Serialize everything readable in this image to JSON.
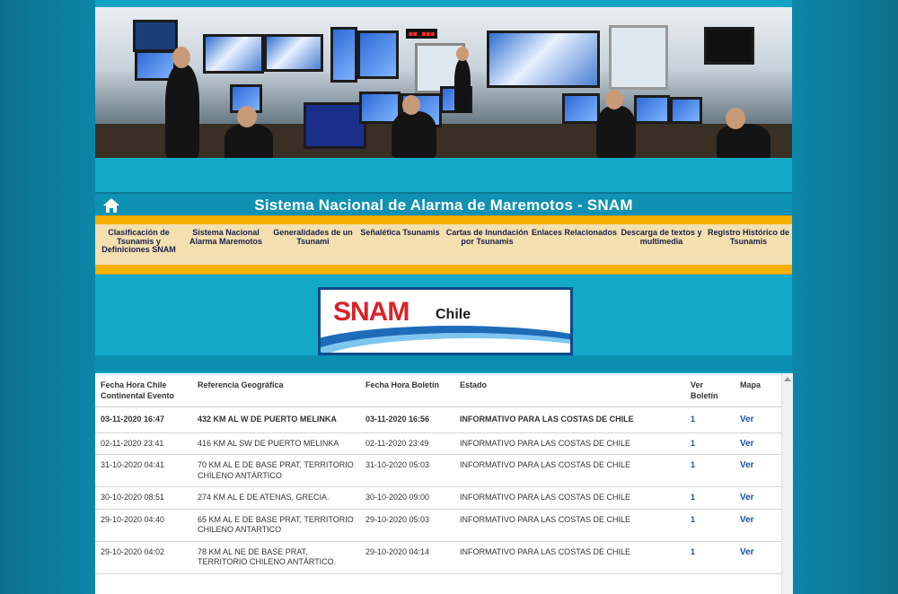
{
  "site": {
    "title": "Sistema Nacional de Alarma de Maremotos - SNAM"
  },
  "nav": [
    {
      "label": "Clasificación de Tsunamis y Definiciones SNAM"
    },
    {
      "label": "Sistema Nacional Alarma Maremotos"
    },
    {
      "label": "Generalidades de un Tsunami"
    },
    {
      "label": "Señalética Tsunamis"
    },
    {
      "label": "Cartas de Inundación por Tsunamis"
    },
    {
      "label": "Enlaces Relacionados"
    },
    {
      "label": "Descarga de textos y multimedia"
    },
    {
      "label": "Registro Histórico de Tsunamis"
    }
  ],
  "logo": {
    "primary": "SNAM",
    "secondary": "Chile"
  },
  "banner": {
    "sign": "◼◼ ◼◼◼"
  },
  "table": {
    "headers": {
      "fecha_evento": "Fecha Hora Chile Continental Evento",
      "referencia": "Referencia Geográfica",
      "fecha_boletin": "Fecha Hora Boletín",
      "estado": "Estado",
      "ver_boletin": "Ver Boletín",
      "mapa": "Mapa"
    },
    "rows": [
      {
        "evento": "03-11-2020 16:47",
        "referencia": "432 KM AL W DE PUERTO MELINKA",
        "boletin": "03-11-2020 16:56",
        "estado": "INFORMATIVO PARA LAS COSTAS DE CHILE",
        "ver": "1",
        "mapa": "Ver"
      },
      {
        "evento": "02-11-2020 23:41",
        "referencia": "416 KM AL SW DE PUERTO MELINKA",
        "boletin": "02-11-2020 23:49",
        "estado": "INFORMATIVO PARA LAS COSTAS DE CHILE",
        "ver": "1",
        "mapa": "Ver"
      },
      {
        "evento": "31-10-2020 04:41",
        "referencia": "70 KM AL E DE BASE PRAT, TERRITORIO CHILENO ANTÁRTICO",
        "boletin": "31-10-2020 05:03",
        "estado": "INFORMATIVO PARA LAS COSTAS DE CHILE",
        "ver": "1",
        "mapa": "Ver"
      },
      {
        "evento": "30-10-2020 08:51",
        "referencia": "274 KM AL E DE ATENAS, GRECIA.",
        "boletin": "30-10-2020 09:00",
        "estado": "INFORMATIVO PARA LAS COSTAS DE CHILE",
        "ver": "1",
        "mapa": "Ver"
      },
      {
        "evento": "29-10-2020 04:40",
        "referencia": "65 KM AL E DE BASE PRAT, TERRITORIO CHILENO ANTARTICO",
        "boletin": "29-10-2020 05:03",
        "estado": "INFORMATIVO PARA LAS COSTAS DE CHILE",
        "ver": "1",
        "mapa": "Ver"
      },
      {
        "evento": "29-10-2020 04:02",
        "referencia": "78 KM AL NE DE BASE PRAT, TERRITORIO CHILENO ANTÁRTICO.",
        "boletin": "29-10-2020 04:14",
        "estado": "INFORMATIVO PARA LAS COSTAS DE CHILE",
        "ver": "1",
        "mapa": "Ver"
      }
    ]
  }
}
